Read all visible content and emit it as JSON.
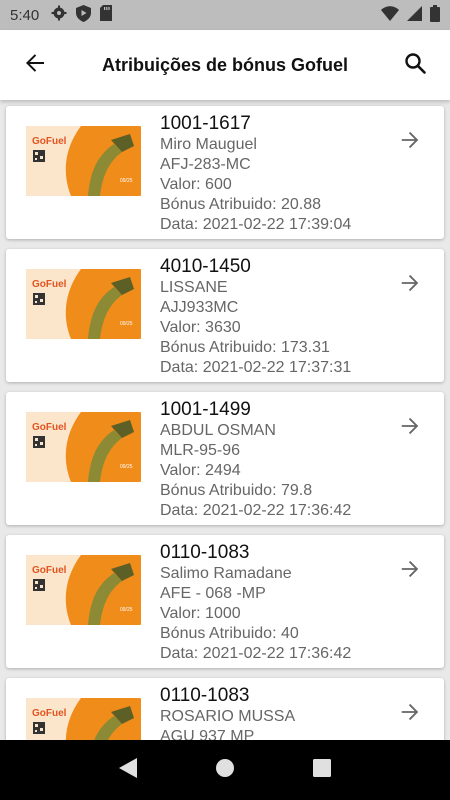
{
  "status_bar": {
    "time": "5:40",
    "icons_left": [
      "gear-icon",
      "shield-icon",
      "sd-card-icon"
    ],
    "icons_right": [
      "wifi-icon",
      "signal-icon",
      "battery-icon"
    ]
  },
  "header": {
    "title": "Atribuições de bónus Gofuel",
    "back_icon": "arrow-back-icon",
    "search_icon": "search-icon"
  },
  "card_image": {
    "brand": "GoFuel",
    "expiry": "09/25",
    "colors": {
      "orange": "#f08c1a",
      "light": "#fbe6cc"
    }
  },
  "items": [
    {
      "code": "1001-1617",
      "name": "Miro Mauguel",
      "plate": "AFJ-283-MC",
      "valor": "Valor: 600",
      "bonus": "Bónus Atribuido: 20.88",
      "data": "Data: 2021-02-22 17:39:04"
    },
    {
      "code": "4010-1450",
      "name": "LISSANE",
      "plate": "AJJ933MC",
      "valor": "Valor: 3630",
      "bonus": "Bónus Atribuido: 173.31",
      "data": "Data: 2021-02-22 17:37:31"
    },
    {
      "code": "1001-1499",
      "name": "ABDUL OSMAN",
      "plate": "MLR-95-96",
      "valor": "Valor: 2494",
      "bonus": "Bónus Atribuido: 79.8",
      "data": "Data: 2021-02-22 17:36:42"
    },
    {
      "code": "0110-1083",
      "name": "Salimo Ramadane",
      "plate": "AFE - 068 -MP",
      "valor": "Valor: 1000",
      "bonus": "Bónus Atribuido: 40",
      "data": "Data: 2021-02-22 17:36:42"
    },
    {
      "code": "0110-1083",
      "name": "ROSARIO MUSSA",
      "plate": "AGU 937 MP",
      "valor": "",
      "bonus": "",
      "data": ""
    }
  ],
  "nav_bar": {
    "icons": [
      "back-triangle-icon",
      "home-circle-icon",
      "recents-square-icon"
    ]
  }
}
